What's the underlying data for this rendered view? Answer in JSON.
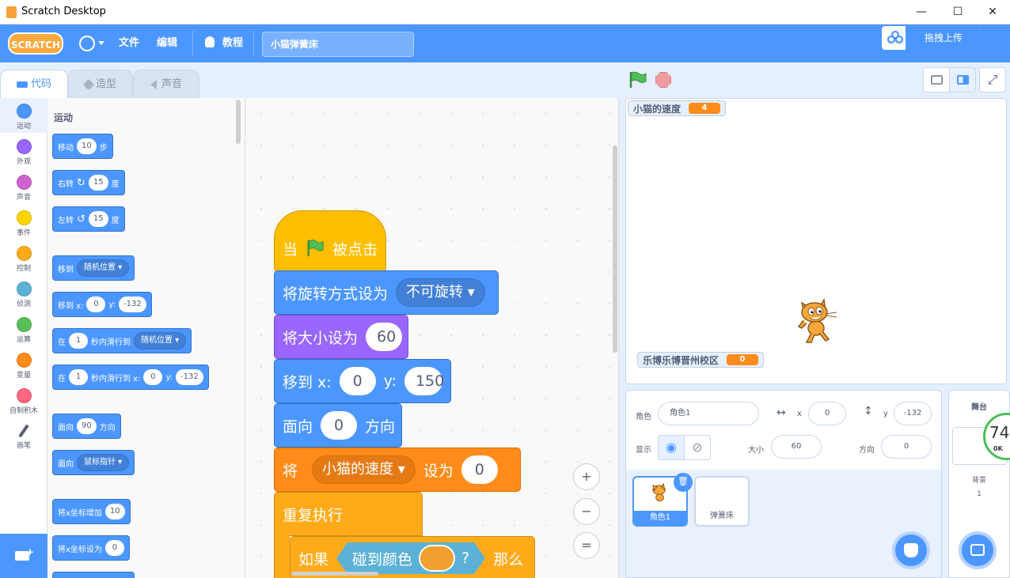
{
  "window": {
    "title": "Scratch Desktop",
    "min": "—",
    "max": "☐",
    "close": "✕"
  },
  "menubar": {
    "logo": "SCRATCH",
    "file": "文件",
    "edit": "编辑",
    "tutorials": "教程",
    "project_title": "小猫弹簧床",
    "upload": "拖拽上传"
  },
  "tabs": {
    "code": "代码",
    "costumes": "造型",
    "sounds": "声音"
  },
  "categories": [
    {
      "label": "运动",
      "color": "#4c97ff"
    },
    {
      "label": "外观",
      "color": "#9966ff"
    },
    {
      "label": "声音",
      "color": "#cf63cf"
    },
    {
      "label": "事件",
      "color": "#ffd500"
    },
    {
      "label": "控制",
      "color": "#ffab19"
    },
    {
      "label": "侦测",
      "color": "#5cb1d6"
    },
    {
      "label": "运算",
      "color": "#59c059"
    },
    {
      "label": "变量",
      "color": "#ff8c1a"
    },
    {
      "label": "自制积木",
      "color": "#ff6680"
    },
    {
      "label": "画笔",
      "color": "#0fbd8c"
    }
  ],
  "palette": {
    "title": "运动",
    "move": {
      "a": "移动",
      "v": "10",
      "b": "步"
    },
    "turn_right": {
      "a": "右转",
      "v": "15",
      "b": "度"
    },
    "turn_left": {
      "a": "左转",
      "v": "15",
      "b": "度"
    },
    "goto": {
      "a": "移到",
      "d": "随机位置"
    },
    "goto_xy": {
      "a": "移到 x:",
      "x": "0",
      "b": "y:",
      "y": "-132"
    },
    "glide": {
      "a": "在",
      "v": "1",
      "b": "秒内滑行到",
      "d": "随机位置"
    },
    "glide_xy": {
      "a": "在",
      "v": "1",
      "b": "秒内滑行到 x:",
      "x": "0",
      "c": "y:",
      "y": "-132"
    },
    "point": {
      "a": "面向",
      "v": "90",
      "b": "方向"
    },
    "point_towards": {
      "a": "面向",
      "d": "鼠标指针"
    },
    "change_x": {
      "a": "将x坐标增加",
      "v": "10"
    },
    "set_x": {
      "a": "将x坐标设为",
      "v": "0"
    }
  },
  "script": {
    "when_flag": {
      "a": "当",
      "b": "被点击"
    },
    "rotation": {
      "a": "将旋转方式设为",
      "d": "不可旋转"
    },
    "size": {
      "a": "将大小设为",
      "v": "60"
    },
    "goto": {
      "a": "移到 x:",
      "x": "0",
      "b": "y:",
      "y": "150"
    },
    "point": {
      "a": "面向",
      "v": "0",
      "b": "方向"
    },
    "setvar": {
      "a": "将",
      "d": "小猫的速度",
      "b": "设为",
      "v": "0"
    },
    "forever": {
      "a": "重复执行"
    },
    "if": {
      "a": "如果",
      "b": "碰到颜色",
      "q": "?",
      "c": "那么"
    },
    "zoom_in": "+",
    "zoom_out": "−",
    "zoom_reset": "="
  },
  "stage": {
    "monitors": [
      {
        "label": "小猫的速度",
        "value": "4"
      },
      {
        "label": "乐博乐博晋州校区",
        "value": "0"
      }
    ]
  },
  "sprite_info": {
    "sprite_label": "角色",
    "sprite_name": "角色1",
    "x_label": "x",
    "x": "0",
    "y_label": "y",
    "y": "-132",
    "show_label": "显示",
    "size_label": "大小",
    "size": "60",
    "dir_label": "方向",
    "direction": "0"
  },
  "sprites": [
    {
      "name": "角色1"
    },
    {
      "name": "弹簧床"
    }
  ],
  "stage_panel": {
    "title": "舞台",
    "backdrops_label": "背景",
    "backdrops_count": "1"
  },
  "overlay": {
    "value": "74",
    "sub": "0K"
  }
}
